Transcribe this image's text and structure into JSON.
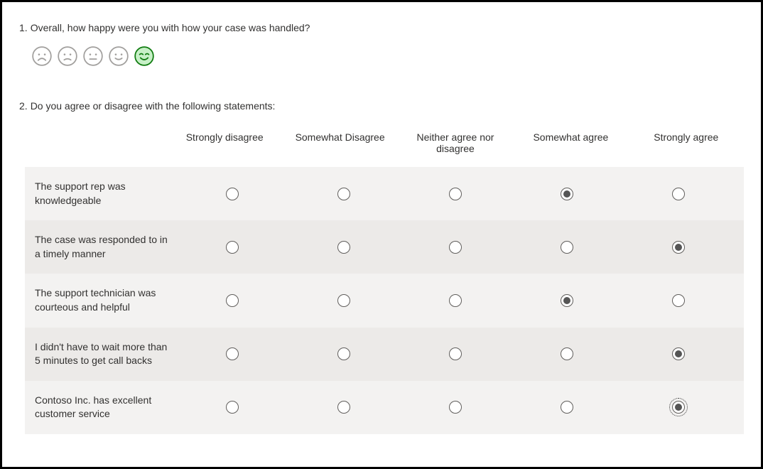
{
  "q1": {
    "number": "1.",
    "text": "Overall, how happy were you with how your case was handled?",
    "selected_index": 4,
    "faces": [
      "very-sad",
      "sad",
      "neutral",
      "happy",
      "very-happy"
    ]
  },
  "q2": {
    "number": "2.",
    "text": "Do you agree or disagree with the following statements:",
    "columns": [
      "Strongly disagree",
      "Somewhat Disagree",
      "Neither agree nor disagree",
      "Somewhat agree",
      "Strongly agree"
    ],
    "rows": [
      {
        "label": "The support rep was knowledgeable",
        "selected": 3
      },
      {
        "label": "The case was responded to in a timely manner",
        "selected": 4
      },
      {
        "label": "The support technician was courteous and helpful",
        "selected": 3
      },
      {
        "label": "I didn't have to wait more than 5 minutes to get call backs",
        "selected": 4
      },
      {
        "label": "Contoso Inc. has excellent customer service",
        "selected": 4,
        "focused": true
      }
    ]
  }
}
